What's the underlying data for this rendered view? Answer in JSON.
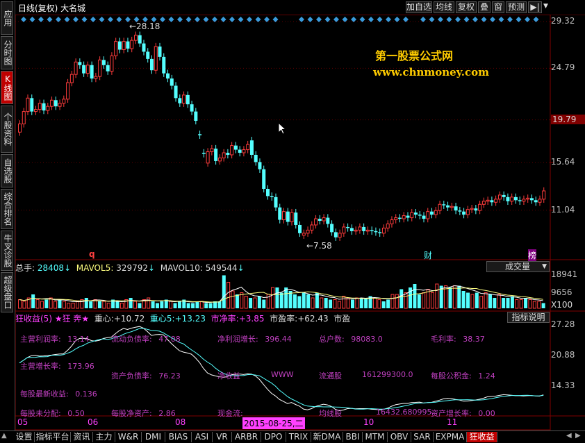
{
  "sidebar": {
    "tabs": [
      {
        "label": "应用",
        "active": false
      },
      {
        "label": "分时图",
        "active": false
      },
      {
        "label": "K线图",
        "active": true
      },
      {
        "label": "个股资料",
        "active": false
      },
      {
        "label": "自选股",
        "active": false
      },
      {
        "label": "综合排名",
        "active": false
      },
      {
        "label": "牛叉诊股",
        "active": false
      },
      {
        "label": "超级盘口",
        "active": false
      }
    ]
  },
  "header": {
    "title": "日线(复权)  大名城",
    "buttons": [
      "加自选",
      "均线",
      "复权",
      "叠",
      "窗",
      "预测"
    ],
    "arrow_icon": "▶|",
    "menu_icon": "▼"
  },
  "price_axis": [
    "29.32",
    "24.79",
    "19.79",
    "15.64",
    "11.04"
  ],
  "price_axis_highlight": "19.79",
  "annotations": {
    "high": "←28.18",
    "low": "←7.58",
    "marker_q": "q",
    "marker_cai": "财",
    "marker_bang": "榜"
  },
  "watermark": {
    "line1": "第一股票公式网",
    "line2": "www.chnmoney.com"
  },
  "volume": {
    "total_label": "总手:",
    "total_value": "28408",
    "mavol5_label": "MAVOL5:",
    "mavol5_value": "329792",
    "mavol10_label": "MAVOL10:",
    "mavol10_value": "549544",
    "selector": "成交量",
    "axis": [
      "18941",
      "9656",
      "X100"
    ]
  },
  "indicator": {
    "name": "狂收益(5)",
    "flag": "★狂 奔★",
    "zx1_label": "重心:",
    "zx1_value": "+10.72",
    "zx2_label": "重心5:",
    "zx2_value": "+13.23",
    "jjl_label": "市净率:",
    "jjl_value": "+3.85",
    "syl_label": "市盈率:",
    "syl_value": "+62.43",
    "extra": "市盈",
    "help": "指标说明",
    "axis": [
      "27.28",
      "20.88",
      "14.33"
    ]
  },
  "fin": {
    "row1": [
      {
        "label": "主营利润率:",
        "value": "13.14"
      },
      {
        "label": "流动负债率:",
        "value": "47.08"
      },
      {
        "label": "净利润增长:",
        "value": "396.44"
      },
      {
        "label": "总户数:",
        "value": "98083.0"
      },
      {
        "label": "毛利率:",
        "value": "38.37"
      }
    ],
    "row2": [
      {
        "label": "主营增长率:",
        "value": "173.96"
      }
    ],
    "row3": [
      {
        "label": "资产负债率:",
        "value": "76.23"
      },
      {
        "label": "净收益",
        "value": ""
      },
      {
        "label": "WWW",
        "value": ""
      },
      {
        "label": "流通股",
        "value": ""
      },
      {
        "label": "",
        "value": "161299300.0"
      },
      {
        "label": "每股公积金:",
        "value": "1.24"
      }
    ],
    "row4": [
      {
        "label": "每股最新收益:",
        "value": "0.136"
      }
    ],
    "row5": [
      {
        "label": "每股未分配:",
        "value": "0.50"
      },
      {
        "label": "每股净资产:",
        "value": "2.86"
      },
      {
        "label": "现金流:",
        "value": ""
      },
      {
        "label": "均线股",
        "value": ""
      },
      {
        "label": "",
        "value": "16432.680995"
      },
      {
        "label": "资产增长率:",
        "value": "0.00"
      }
    ]
  },
  "date_axis": {
    "labels": [
      "05",
      "06",
      "08",
      "10",
      "11"
    ],
    "selected": "2015-08-25,二"
  },
  "bottom_tabs": {
    "tabs": [
      "设置",
      "指标平台",
      "资讯",
      "主力",
      "W&R",
      "DMI",
      "BIAS",
      "ASI",
      "VR",
      "ARBR",
      "DPO",
      "TRIX",
      "新DMA",
      "BBI",
      "MTM",
      "OBV",
      "SAR",
      "EXPMA",
      "狂收益"
    ],
    "active": "狂收益"
  },
  "colors": {
    "up": "#ff3c3c",
    "down": "#54ffff",
    "price_axis_bg": "#800000",
    "diamond": "#3a9bdc",
    "watermark": "#ffcc00"
  },
  "chart_data": {
    "type": "candlestick",
    "title": "日线(复权)  大名城",
    "ylim": [
      6.5,
      30
    ],
    "yticks": [
      29.32,
      24.79,
      19.79,
      15.64,
      11.04
    ],
    "high_marker": 28.18,
    "low_marker": 7.58,
    "x_labels": [
      "05",
      "06",
      "08",
      "10",
      "11"
    ],
    "candles": [
      {
        "o": 18.6,
        "c": 19.4
      },
      {
        "o": 19.4,
        "c": 20.6
      },
      {
        "o": 20.6,
        "c": 21.9
      },
      {
        "o": 21.9,
        "c": 20.6
      },
      {
        "o": 20.6,
        "c": 20.8
      },
      {
        "o": 20.8,
        "c": 21.4
      },
      {
        "o": 21.4,
        "c": 20.7
      },
      {
        "o": 20.7,
        "c": 21.1
      },
      {
        "o": 21.1,
        "c": 21.7
      },
      {
        "o": 21.7,
        "c": 21.1
      },
      {
        "o": 21.1,
        "c": 21.4
      },
      {
        "o": 21.4,
        "c": 21.8
      },
      {
        "o": 21.8,
        "c": 23.4
      },
      {
        "o": 23.4,
        "c": 24.2
      },
      {
        "o": 24.2,
        "c": 25.4
      },
      {
        "o": 25.4,
        "c": 25.1
      },
      {
        "o": 25.1,
        "c": 24.3
      },
      {
        "o": 24.3,
        "c": 25.1
      },
      {
        "o": 25.1,
        "c": 23.8
      },
      {
        "o": 23.8,
        "c": 24.0
      },
      {
        "o": 24.0,
        "c": 25.6
      },
      {
        "o": 25.6,
        "c": 25.1
      },
      {
        "o": 25.1,
        "c": 24.5
      },
      {
        "o": 24.5,
        "c": 26.0
      },
      {
        "o": 26.0,
        "c": 27.4
      },
      {
        "o": 27.4,
        "c": 26.6
      },
      {
        "o": 26.6,
        "c": 27.4
      },
      {
        "o": 27.4,
        "c": 26.7
      },
      {
        "o": 26.7,
        "c": 27.5
      },
      {
        "o": 27.5,
        "c": 28.0
      },
      {
        "o": 28.0,
        "c": 27.2
      },
      {
        "o": 27.2,
        "c": 26.4
      },
      {
        "o": 26.4,
        "c": 25.7
      },
      {
        "o": 25.7,
        "c": 24.6
      },
      {
        "o": 24.6,
        "c": 26.9
      },
      {
        "o": 26.9,
        "c": 25.9
      },
      {
        "o": 25.9,
        "c": 24.3
      },
      {
        "o": 24.3,
        "c": 23.8
      },
      {
        "o": 23.8,
        "c": 23.1
      },
      {
        "o": 23.1,
        "c": 21.9
      },
      {
        "o": 21.9,
        "c": 21.4
      },
      {
        "o": 21.4,
        "c": 22.2
      },
      {
        "o": 22.2,
        "c": 21.3
      },
      {
        "o": 21.3,
        "c": 20.6
      },
      {
        "o": 20.6,
        "c": 19.7
      },
      {
        "o": 18.4,
        "c": 18.3
      },
      {
        "o": 16.6,
        "c": 16.5
      },
      {
        "o": 15.6,
        "c": 16.7
      },
      {
        "o": 16.7,
        "c": 17.0
      },
      {
        "o": 17.0,
        "c": 15.8
      },
      {
        "o": 15.8,
        "c": 16.1
      },
      {
        "o": 16.1,
        "c": 16.6
      },
      {
        "o": 16.6,
        "c": 16.4
      },
      {
        "o": 16.4,
        "c": 17.3
      },
      {
        "o": 17.3,
        "c": 16.9
      },
      {
        "o": 16.9,
        "c": 16.6
      },
      {
        "o": 16.6,
        "c": 16.9
      },
      {
        "o": 16.9,
        "c": 17.4
      },
      {
        "o": 17.8,
        "c": 16.4
      },
      {
        "o": 16.4,
        "c": 15.7
      },
      {
        "o": 15.7,
        "c": 15.0
      },
      {
        "o": 15.0,
        "c": 13.1
      },
      {
        "o": 13.1,
        "c": 12.4
      },
      {
        "o": 12.4,
        "c": 12.3
      },
      {
        "o": 12.3,
        "c": 11.3
      },
      {
        "o": 11.3,
        "c": 10.1
      },
      {
        "o": 10.1,
        "c": 10.9
      },
      {
        "o": 10.9,
        "c": 9.9
      },
      {
        "o": 9.9,
        "c": 10.8
      },
      {
        "o": 10.8,
        "c": 9.6
      },
      {
        "o": 9.6,
        "c": 8.8
      },
      {
        "o": 8.6,
        "c": 8.8
      },
      {
        "o": 8.8,
        "c": 9.1
      },
      {
        "o": 9.1,
        "c": 9.6
      },
      {
        "o": 9.6,
        "c": 10.2
      },
      {
        "o": 10.2,
        "c": 10.0
      },
      {
        "o": 10.0,
        "c": 10.3
      },
      {
        "o": 10.3,
        "c": 9.7
      },
      {
        "o": 9.7,
        "c": 8.9
      },
      {
        "o": 8.9,
        "c": 8.4
      },
      {
        "o": 8.4,
        "c": 8.8
      },
      {
        "o": 8.8,
        "c": 9.4
      },
      {
        "o": 9.4,
        "c": 9.3
      },
      {
        "o": 9.3,
        "c": 9.0
      },
      {
        "o": 9.0,
        "c": 9.1
      },
      {
        "o": 9.1,
        "c": 9.4
      },
      {
        "o": 9.4,
        "c": 9.0
      },
      {
        "o": 9.0,
        "c": 9.1
      },
      {
        "o": 9.1,
        "c": 9.0
      },
      {
        "o": 9.0,
        "c": 8.9
      },
      {
        "o": 8.9,
        "c": 8.8
      },
      {
        "o": 8.8,
        "c": 9.3
      },
      {
        "o": 9.3,
        "c": 9.7
      },
      {
        "o": 9.7,
        "c": 10.1
      },
      {
        "o": 10.1,
        "c": 10.3
      },
      {
        "o": 10.3,
        "c": 10.2
      },
      {
        "o": 10.2,
        "c": 10.5
      },
      {
        "o": 10.5,
        "c": 10.3
      },
      {
        "o": 10.3,
        "c": 10.8
      },
      {
        "o": 10.8,
        "c": 10.6
      },
      {
        "o": 10.6,
        "c": 10.5
      },
      {
        "o": 10.5,
        "c": 10.2
      },
      {
        "o": 10.2,
        "c": 10.9
      },
      {
        "o": 10.9,
        "c": 10.6
      },
      {
        "o": 10.6,
        "c": 11.0
      },
      {
        "o": 11.0,
        "c": 11.6
      },
      {
        "o": 11.6,
        "c": 11.5
      },
      {
        "o": 11.5,
        "c": 11.3
      },
      {
        "o": 11.3,
        "c": 11.4
      },
      {
        "o": 11.4,
        "c": 11.0
      },
      {
        "o": 11.0,
        "c": 10.9
      },
      {
        "o": 10.9,
        "c": 10.6
      },
      {
        "o": 10.6,
        "c": 11.1
      },
      {
        "o": 11.1,
        "c": 11.2
      },
      {
        "o": 11.2,
        "c": 11.0
      },
      {
        "o": 11.0,
        "c": 11.6
      },
      {
        "o": 11.6,
        "c": 11.9
      },
      {
        "o": 11.9,
        "c": 12.0
      },
      {
        "o": 12.0,
        "c": 11.8
      },
      {
        "o": 11.8,
        "c": 12.1
      },
      {
        "o": 12.1,
        "c": 12.5
      },
      {
        "o": 12.5,
        "c": 12.3
      },
      {
        "o": 12.3,
        "c": 11.9
      },
      {
        "o": 11.9,
        "c": 12.3
      },
      {
        "o": 12.3,
        "c": 12.0
      },
      {
        "o": 12.0,
        "c": 11.9
      },
      {
        "o": 11.9,
        "c": 12.1
      },
      {
        "o": 12.1,
        "c": 12.2
      },
      {
        "o": 12.2,
        "c": 12.0
      },
      {
        "o": 12.0,
        "c": 11.8
      },
      {
        "o": 11.8,
        "c": 12.1
      },
      {
        "o": 12.1,
        "c": 12.9
      }
    ],
    "volume_series": [
      5,
      4,
      6,
      8,
      5,
      4,
      5,
      6,
      4,
      5,
      4,
      3,
      3,
      4,
      5,
      6,
      4,
      5,
      4,
      4,
      3,
      5,
      4,
      3,
      5,
      6,
      4,
      3,
      5,
      6,
      4,
      3,
      4,
      5,
      4,
      3,
      4,
      5,
      3,
      3,
      4,
      4,
      3,
      3,
      4,
      4,
      19,
      15,
      10,
      8,
      9,
      7,
      6,
      6,
      7,
      5,
      8,
      12,
      12,
      9,
      12,
      10,
      8,
      7,
      9,
      8,
      6,
      9,
      6,
      6,
      5,
      5,
      4,
      7,
      6,
      5,
      6,
      6,
      6,
      7,
      6,
      5,
      4,
      5,
      8,
      8,
      11,
      9,
      12,
      14,
      8,
      9,
      11,
      9,
      14,
      13,
      13,
      12,
      13,
      13,
      10,
      9,
      8,
      9,
      7,
      9,
      8,
      6,
      8,
      6,
      6,
      7,
      5,
      5,
      6,
      5,
      4,
      4,
      3
    ]
  }
}
